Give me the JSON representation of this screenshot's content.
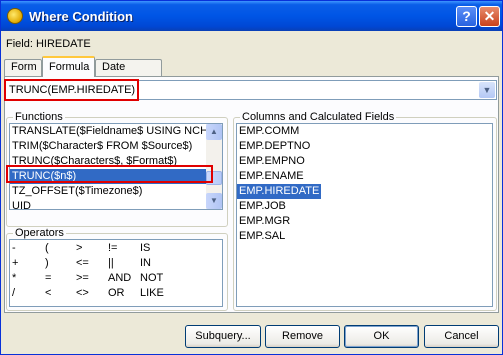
{
  "window": {
    "title": "Where Condition",
    "help_label": "?",
    "close_label": "✕"
  },
  "field_label": "Field: HIREDATE",
  "tabs": [
    {
      "label": "Form",
      "active": false
    },
    {
      "label": "Formula",
      "active": true
    },
    {
      "label": "Date Range",
      "active": false
    }
  ],
  "formula": {
    "value": "TRUNC(EMP.HIREDATE)"
  },
  "functions": {
    "label": "Functions",
    "items": [
      "TRANSLATE($Fieldname$ USING NCHAR",
      "TRIM($Character$ FROM $Source$)",
      "TRUNC($Characters$, $Format$)",
      "TRUNC($n$)",
      "TZ_OFFSET($Timezone$)",
      "UID"
    ],
    "selected_index": 3
  },
  "columns": {
    "label": "Columns and Calculated Fields",
    "items": [
      "EMP.COMM",
      "EMP.DEPTNO",
      "EMP.EMPNO",
      "EMP.ENAME",
      "EMP.HIREDATE",
      "EMP.JOB",
      "EMP.MGR",
      "EMP.SAL"
    ],
    "selected_index": 4
  },
  "operators": {
    "label": "Operators",
    "rows": [
      [
        "-",
        "(",
        ">",
        "!=",
        "IS"
      ],
      [
        "+",
        ")",
        "<=",
        "||",
        "IN"
      ],
      [
        "*",
        "=",
        ">=",
        "AND",
        "NOT"
      ],
      [
        "/",
        "<",
        "<>",
        "OR",
        "LIKE"
      ]
    ]
  },
  "buttons": {
    "subquery": "Subquery...",
    "remove": "Remove",
    "ok": "OK",
    "cancel": "Cancel"
  },
  "colors": {
    "selection": "#316ac5",
    "highlight_box": "#e00000",
    "titlebar": "#0055e5"
  }
}
